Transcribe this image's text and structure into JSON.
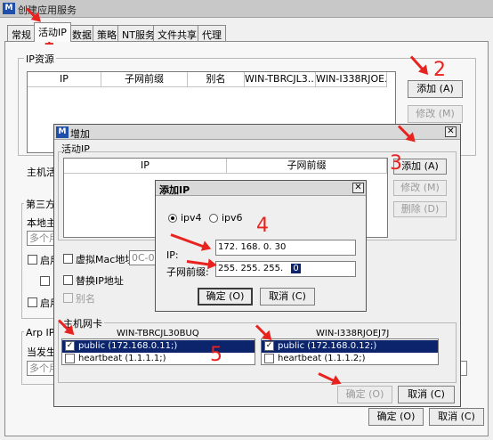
{
  "window": {
    "title": "创建应用服务",
    "icon": "app-logo-icon"
  },
  "tabs": [
    {
      "label": "常规"
    },
    {
      "label": "活动IP"
    },
    {
      "label": "数据"
    },
    {
      "label": "策略"
    },
    {
      "label": "NT服务"
    },
    {
      "label": "文件共享"
    },
    {
      "label": "代理"
    }
  ],
  "main": {
    "ip_resource_group": "IP资源",
    "columns": [
      "IP",
      "子网前缀",
      "别名",
      "WIN-TBRCJL3...",
      "WIN-I338RJOE..."
    ],
    "add_button": "添加 (A)",
    "modify_button": "修改 (M)",
    "host_label": "主机活",
    "third_group": "第三方",
    "local_label": "本地主",
    "local_placeholder": "多个用",
    "enable1": "启用",
    "enable2": "启用",
    "arp_group": "Arp IP列",
    "when_label": "当发生",
    "arp_placeholder": "多个用",
    "ok_button": "确定 (O)",
    "cancel_button": "取消 (C)"
  },
  "add_dialog": {
    "title": "增加",
    "active_ip_group": "活动IP",
    "columns": [
      "IP",
      "子网前缀"
    ],
    "add_button": "添加 (A)",
    "modify_button": "修改 (M)",
    "delete_button": "删除 (D)",
    "virtual_mac": "虚拟Mac地址",
    "mac_value": "0C-09-",
    "replace_ip": "替换IP地址",
    "alias": "别名",
    "nic_group": "主机网卡",
    "nic_hosts": [
      {
        "name": "WIN-TBRCJL30BUQ",
        "items": [
          {
            "label": "public (172.168.0.11;)",
            "checked": true,
            "selected": true
          },
          {
            "label": "heartbeat (1.1.1.1;)",
            "checked": false,
            "selected": false
          }
        ]
      },
      {
        "name": "WIN-I338RJOEJ7J",
        "items": [
          {
            "label": "public (172.168.0.12;)",
            "checked": true,
            "selected": true
          },
          {
            "label": "heartbeat (1.1.1.2;)",
            "checked": false,
            "selected": false
          }
        ]
      }
    ],
    "ok_button": "确定 (O)",
    "cancel_button": "取消 (C)"
  },
  "add_ip_dialog": {
    "title": "添加IP",
    "ipv4": "ipv4",
    "ipv6": "ipv6",
    "ip_label": "IP:",
    "ip_value": "172. 168.   0.  30",
    "prefix_label": "子网前缀:",
    "prefix_value": "255. 255. 255.",
    "prefix_last": "0",
    "ok_button": "确定 (O)",
    "cancel_button": "取消 (C)"
  },
  "annotations": [
    "1",
    "2",
    "3",
    "4",
    "5"
  ],
  "colors": {
    "annotation": "#e8231f",
    "selection": "#0b246b"
  }
}
